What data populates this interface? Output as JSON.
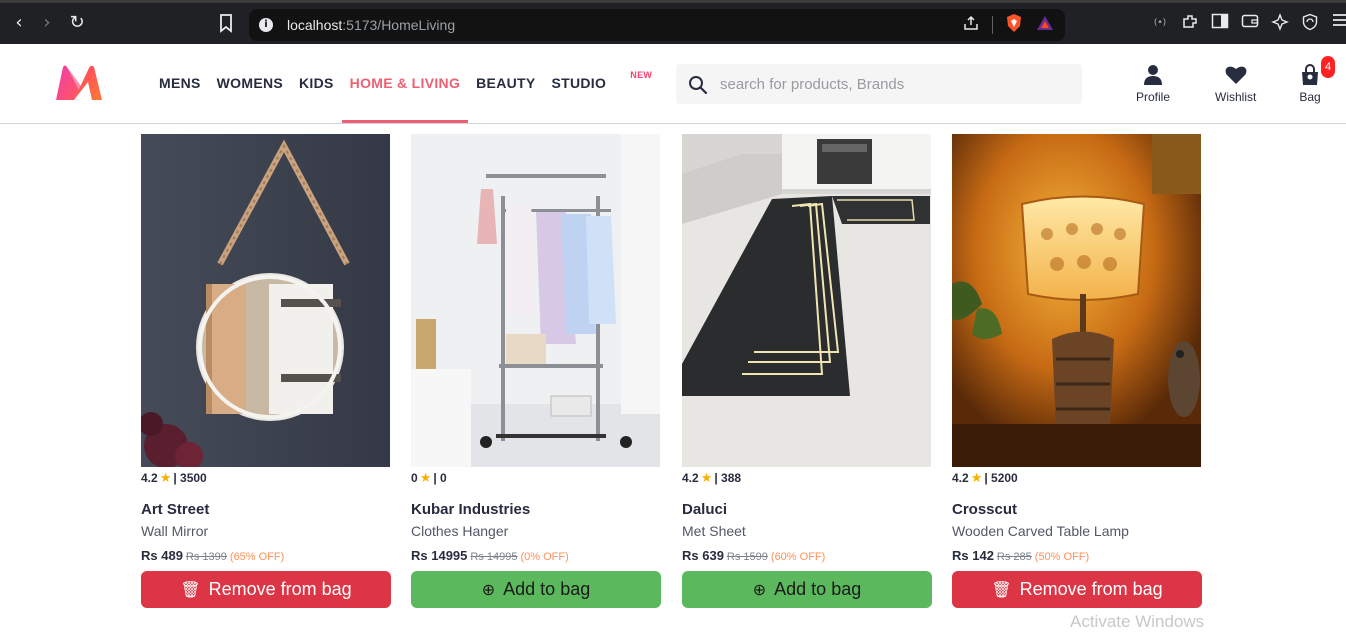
{
  "browser": {
    "back_icon": "‹",
    "forward_icon": "›",
    "reload_icon": "↻",
    "url_host": "localhost",
    "url_path": ":5173/HomeLiving"
  },
  "header": {
    "menu": [
      {
        "label": "MENS"
      },
      {
        "label": "WOMENS"
      },
      {
        "label": "KIDS"
      },
      {
        "label": "HOME & LIVING"
      },
      {
        "label": "BEAUTY"
      },
      {
        "label": "STUDIO"
      }
    ],
    "studio_badge": "NEW",
    "search_placeholder": "search for products, Brands",
    "profile_label": "Profile",
    "wishlist_label": "Wishlist",
    "bag_label": "Bag",
    "bag_count": "4",
    "accent_color": "#ee5f73"
  },
  "products": [
    {
      "rating": "4.2",
      "reviews": "| 3500",
      "brand": "Art Street",
      "type": "Wall Mirror",
      "price": "Rs 489",
      "mrp": "Rs 1399",
      "discount": "(65% OFF)",
      "cta_label": "Remove from bag",
      "cta_icon": "trash-icon",
      "in_bag": true
    },
    {
      "rating": "0",
      "reviews": "| 0",
      "brand": "Kubar Industries",
      "type": "Clothes Hanger",
      "price": "Rs 14995",
      "mrp": "Rs 14995",
      "discount": "(0% OFF)",
      "cta_label": "Add to bag",
      "cta_icon": "plus-circle-icon",
      "in_bag": false
    },
    {
      "rating": "4.2",
      "reviews": "| 388",
      "brand": "Daluci",
      "type": "Met Sheet",
      "price": "Rs 639",
      "mrp": "Rs 1599",
      "discount": "(60% OFF)",
      "cta_label": "Add to bag",
      "cta_icon": "plus-circle-icon",
      "in_bag": false
    },
    {
      "rating": "4.2",
      "reviews": "| 5200",
      "brand": "Crosscut",
      "type": "Wooden Carved Table Lamp",
      "price": "Rs 142",
      "mrp": "Rs 285",
      "discount": "(50% OFF)",
      "cta_label": "Remove from bag",
      "cta_icon": "trash-icon",
      "in_bag": true
    }
  ],
  "watermark": "Activate Windows"
}
